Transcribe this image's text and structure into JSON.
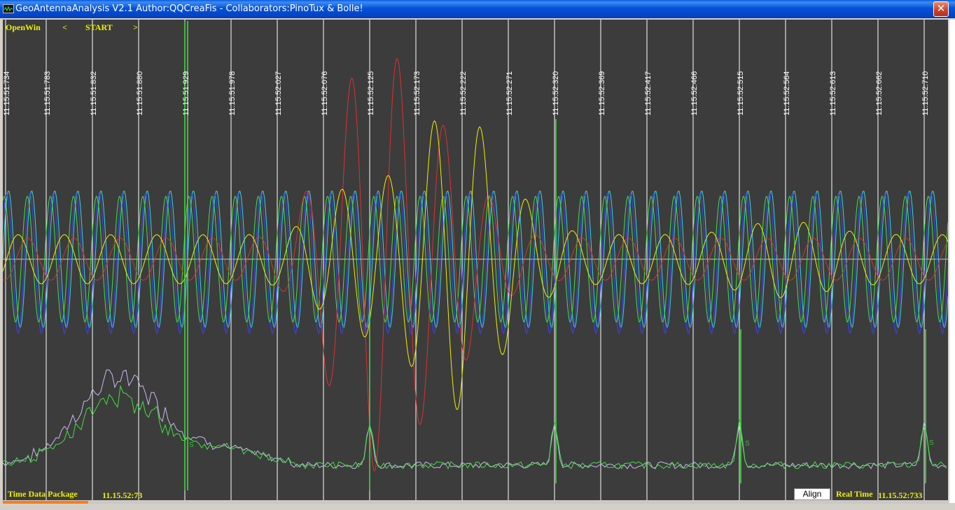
{
  "window": {
    "title": "GeoAntennaAnalysis V2.1 Author:QQCreaFis - Collaborators:PinoTux & Bolle!",
    "close_glyph": "✕"
  },
  "toolbar": {
    "open_label": "OpenWin",
    "prev_label": "<",
    "start_label": "START",
    "next_label": ">"
  },
  "footer": {
    "package_label": "Time Data Package",
    "package_time": "11.15.52:73",
    "align_label": "Align",
    "realtime_label": "Real Time",
    "realtime_value": "11.15.52:733",
    "progress_fraction": 0.09
  },
  "timestamps": [
    "11.15.51:734",
    "11.15.51:783",
    "11.15.51:832",
    "11.15.51:880",
    "11.15.51:929",
    "11.15.51:978",
    "11.15.52:027",
    "11.15.52:076",
    "11.15.52:125",
    "11.15.52:173",
    "11.15.52:222",
    "11.15.52:271",
    "11.15.52:320",
    "11.15.52:369",
    "11.15.52:417",
    "11.15.52:466",
    "11.15.52:515",
    "11.15.52:564",
    "11.15.52:613",
    "11.15.52:662",
    "11.15.52:710"
  ],
  "peak_labels": [
    "S",
    "S",
    "S"
  ],
  "colors": {
    "background": "#3c3c3c",
    "grid": "#ffffff",
    "label_yellow": "#f0f000",
    "series_cyan": "#30d8d8",
    "series_green": "#40e040",
    "series_blue": "#4040ff",
    "series_red": "#e03030",
    "series_yellow": "#f0f000",
    "series_lavender": "#c8b8f0",
    "progress": "#ff7a1a"
  }
}
